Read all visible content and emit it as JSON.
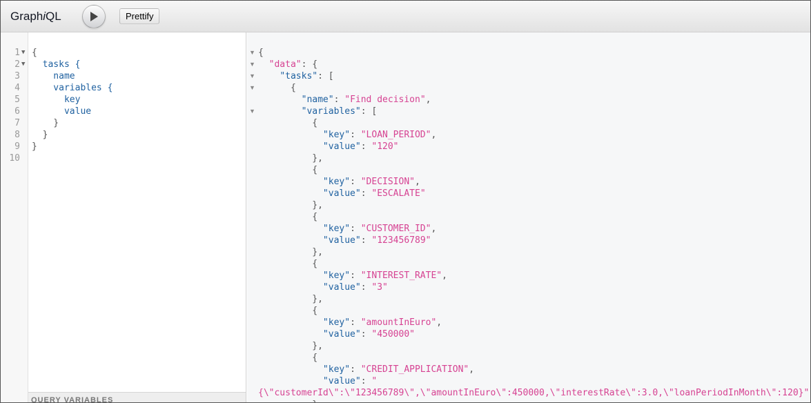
{
  "app": {
    "title_pre": "Graph",
    "title_em": "i",
    "title_post": "QL",
    "execute_icon": "play-icon",
    "prettify_label": "Prettify"
  },
  "query_editor": {
    "lines": [
      {
        "num": "1",
        "fold": true,
        "text": "{"
      },
      {
        "num": "2",
        "fold": true,
        "text": "  tasks {"
      },
      {
        "num": "3",
        "fold": false,
        "text": "    name"
      },
      {
        "num": "4",
        "fold": false,
        "text": "    variables {"
      },
      {
        "num": "5",
        "fold": false,
        "text": "      key"
      },
      {
        "num": "6",
        "fold": false,
        "text": "      value"
      },
      {
        "num": "7",
        "fold": false,
        "text": "    }"
      },
      {
        "num": "8",
        "fold": false,
        "text": "  }"
      },
      {
        "num": "9",
        "fold": false,
        "text": "}"
      },
      {
        "num": "10",
        "fold": false,
        "text": ""
      }
    ],
    "variables_header": "QUERY VARIABLES"
  },
  "result": {
    "lines": [
      {
        "fold": true,
        "parts": [
          [
            "p",
            "{"
          ]
        ]
      },
      {
        "fold": true,
        "parts": [
          [
            "p",
            "  "
          ],
          [
            "s",
            "\"data\""
          ],
          [
            "p",
            ": {"
          ]
        ]
      },
      {
        "fold": true,
        "parts": [
          [
            "p",
            "    "
          ],
          [
            "k",
            "\"tasks\""
          ],
          [
            "p",
            ": ["
          ]
        ]
      },
      {
        "fold": true,
        "parts": [
          [
            "p",
            "      {"
          ]
        ]
      },
      {
        "fold": false,
        "parts": [
          [
            "p",
            "        "
          ],
          [
            "k",
            "\"name\""
          ],
          [
            "p",
            ": "
          ],
          [
            "s",
            "\"Find decision\""
          ],
          [
            "p",
            ","
          ]
        ]
      },
      {
        "fold": true,
        "parts": [
          [
            "p",
            "        "
          ],
          [
            "k",
            "\"variables\""
          ],
          [
            "p",
            ": ["
          ]
        ]
      },
      {
        "fold": false,
        "parts": [
          [
            "p",
            "          {"
          ]
        ]
      },
      {
        "fold": false,
        "parts": [
          [
            "p",
            "            "
          ],
          [
            "k",
            "\"key\""
          ],
          [
            "p",
            ": "
          ],
          [
            "s",
            "\"LOAN_PERIOD\""
          ],
          [
            "p",
            ","
          ]
        ]
      },
      {
        "fold": false,
        "parts": [
          [
            "p",
            "            "
          ],
          [
            "k",
            "\"value\""
          ],
          [
            "p",
            ": "
          ],
          [
            "s",
            "\"120\""
          ]
        ]
      },
      {
        "fold": false,
        "parts": [
          [
            "p",
            "          },"
          ]
        ]
      },
      {
        "fold": false,
        "parts": [
          [
            "p",
            "          {"
          ]
        ]
      },
      {
        "fold": false,
        "parts": [
          [
            "p",
            "            "
          ],
          [
            "k",
            "\"key\""
          ],
          [
            "p",
            ": "
          ],
          [
            "s",
            "\"DECISION\""
          ],
          [
            "p",
            ","
          ]
        ]
      },
      {
        "fold": false,
        "parts": [
          [
            "p",
            "            "
          ],
          [
            "k",
            "\"value\""
          ],
          [
            "p",
            ": "
          ],
          [
            "s",
            "\"ESCALATE\""
          ]
        ]
      },
      {
        "fold": false,
        "parts": [
          [
            "p",
            "          },"
          ]
        ]
      },
      {
        "fold": false,
        "parts": [
          [
            "p",
            "          {"
          ]
        ]
      },
      {
        "fold": false,
        "parts": [
          [
            "p",
            "            "
          ],
          [
            "k",
            "\"key\""
          ],
          [
            "p",
            ": "
          ],
          [
            "s",
            "\"CUSTOMER_ID\""
          ],
          [
            "p",
            ","
          ]
        ]
      },
      {
        "fold": false,
        "parts": [
          [
            "p",
            "            "
          ],
          [
            "k",
            "\"value\""
          ],
          [
            "p",
            ": "
          ],
          [
            "s",
            "\"123456789\""
          ]
        ]
      },
      {
        "fold": false,
        "parts": [
          [
            "p",
            "          },"
          ]
        ]
      },
      {
        "fold": false,
        "parts": [
          [
            "p",
            "          {"
          ]
        ]
      },
      {
        "fold": false,
        "parts": [
          [
            "p",
            "            "
          ],
          [
            "k",
            "\"key\""
          ],
          [
            "p",
            ": "
          ],
          [
            "s",
            "\"INTEREST_RATE\""
          ],
          [
            "p",
            ","
          ]
        ]
      },
      {
        "fold": false,
        "parts": [
          [
            "p",
            "            "
          ],
          [
            "k",
            "\"value\""
          ],
          [
            "p",
            ": "
          ],
          [
            "s",
            "\"3\""
          ]
        ]
      },
      {
        "fold": false,
        "parts": [
          [
            "p",
            "          },"
          ]
        ]
      },
      {
        "fold": false,
        "parts": [
          [
            "p",
            "          {"
          ]
        ]
      },
      {
        "fold": false,
        "parts": [
          [
            "p",
            "            "
          ],
          [
            "k",
            "\"key\""
          ],
          [
            "p",
            ": "
          ],
          [
            "s",
            "\"amountInEuro\""
          ],
          [
            "p",
            ","
          ]
        ]
      },
      {
        "fold": false,
        "parts": [
          [
            "p",
            "            "
          ],
          [
            "k",
            "\"value\""
          ],
          [
            "p",
            ": "
          ],
          [
            "s",
            "\"450000\""
          ]
        ]
      },
      {
        "fold": false,
        "parts": [
          [
            "p",
            "          },"
          ]
        ]
      },
      {
        "fold": false,
        "parts": [
          [
            "p",
            "          {"
          ]
        ]
      },
      {
        "fold": false,
        "parts": [
          [
            "p",
            "            "
          ],
          [
            "k",
            "\"key\""
          ],
          [
            "p",
            ": "
          ],
          [
            "s",
            "\"CREDIT_APPLICATION\""
          ],
          [
            "p",
            ","
          ]
        ]
      },
      {
        "fold": false,
        "parts": [
          [
            "p",
            "            "
          ],
          [
            "k",
            "\"value\""
          ],
          [
            "p",
            ": "
          ],
          [
            "s",
            "\""
          ]
        ]
      },
      {
        "fold": false,
        "parts": [
          [
            "s",
            "{\\\"customerId\\\":\\\"123456789\\\",\\\"amountInEuro\\\":450000,\\\"interestRate\\\":3.0,\\\"loanPeriodInMonth\\\":120}\""
          ]
        ]
      },
      {
        "fold": false,
        "parts": [
          [
            "p",
            "          }"
          ]
        ]
      }
    ]
  }
}
